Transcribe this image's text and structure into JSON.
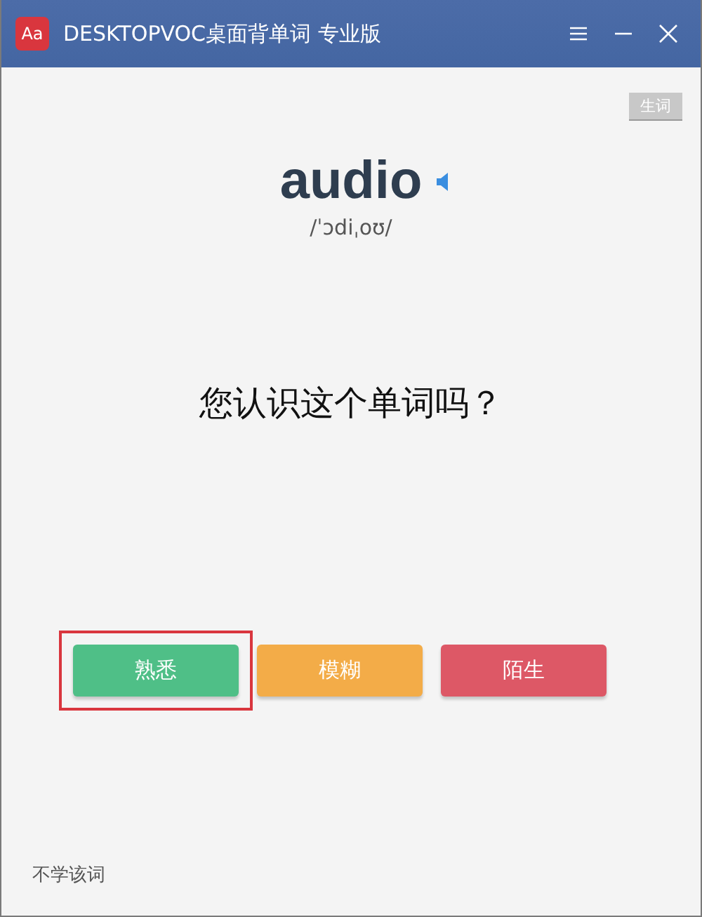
{
  "window": {
    "logo": "Aa",
    "title": "DESKTOPVOC桌面背单词 专业版",
    "controls": [
      {
        "kind": "menu"
      },
      {
        "kind": "minimize"
      },
      {
        "kind": "close"
      }
    ]
  },
  "tag": "生词",
  "word": {
    "text": "audio",
    "phonetic": "/ˈɔdiˌoʊ/"
  },
  "question": "您认识这个单词吗？",
  "answers": [
    {
      "label": "熟悉",
      "color": "#4fbf87",
      "highlighted": true
    },
    {
      "label": "模糊",
      "color": "#f3ac48",
      "highlighted": false
    },
    {
      "label": "陌生",
      "color": "#dd5866",
      "highlighted": false
    }
  ],
  "skip": "不学该词"
}
